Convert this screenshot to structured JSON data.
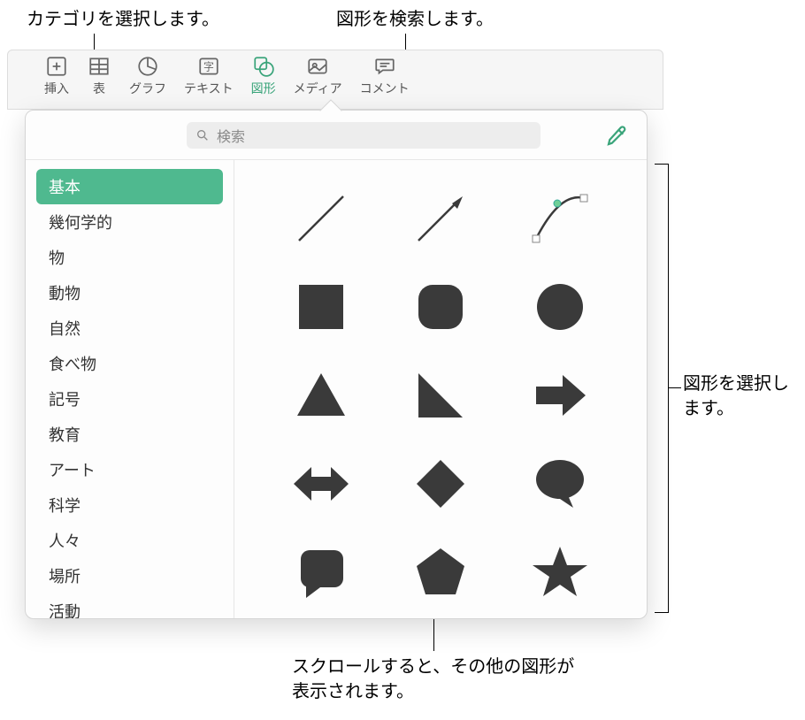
{
  "callouts": {
    "top_left": "カテゴリを選択します。",
    "top_right": "図形を検索します。",
    "right": "図形を選択します。",
    "bottom": "スクロールすると、その他の図形が表示されます。"
  },
  "toolbar": {
    "items": [
      {
        "label": "挿入",
        "icon": "insert"
      },
      {
        "label": "表",
        "icon": "table"
      },
      {
        "label": "グラフ",
        "icon": "chart"
      },
      {
        "label": "テキスト",
        "icon": "text"
      },
      {
        "label": "図形",
        "icon": "shape",
        "active": true
      },
      {
        "label": "メディア",
        "icon": "media"
      },
      {
        "label": "コメント",
        "icon": "comment"
      }
    ]
  },
  "search": {
    "placeholder": "検索"
  },
  "sidebar": {
    "items": [
      {
        "label": "基本",
        "selected": true
      },
      {
        "label": "幾何学的"
      },
      {
        "label": "物"
      },
      {
        "label": "動物"
      },
      {
        "label": "自然"
      },
      {
        "label": "食べ物"
      },
      {
        "label": "記号"
      },
      {
        "label": "教育"
      },
      {
        "label": "アート"
      },
      {
        "label": "科学"
      },
      {
        "label": "人々"
      },
      {
        "label": "場所"
      },
      {
        "label": "活動"
      }
    ]
  },
  "shapes": [
    {
      "name": "line"
    },
    {
      "name": "arrow-line"
    },
    {
      "name": "curve"
    },
    {
      "name": "square"
    },
    {
      "name": "rounded-square"
    },
    {
      "name": "circle"
    },
    {
      "name": "triangle"
    },
    {
      "name": "right-triangle"
    },
    {
      "name": "arrow-right"
    },
    {
      "name": "arrow-bidirectional"
    },
    {
      "name": "diamond"
    },
    {
      "name": "speech-bubble"
    },
    {
      "name": "callout-square"
    },
    {
      "name": "pentagon"
    },
    {
      "name": "star"
    }
  ],
  "colors": {
    "accent": "#4fb98f",
    "shape": "#3a3a3a"
  }
}
